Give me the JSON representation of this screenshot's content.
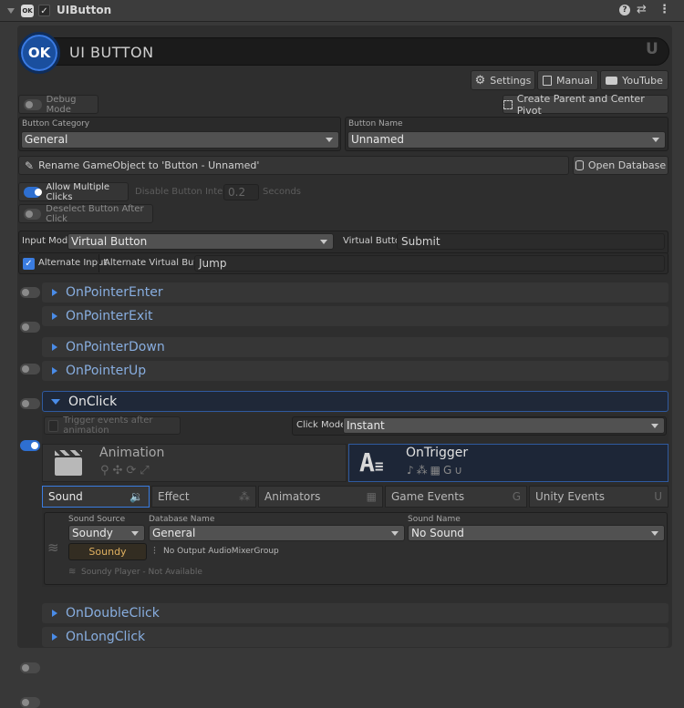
{
  "header": {
    "title": "UIButton"
  },
  "banner": {
    "logo": "OK",
    "title": "UI BUTTON"
  },
  "toolbar": {
    "settings": "Settings",
    "manual": "Manual",
    "youtube": "YouTube"
  },
  "debug_mode": "Debug Mode",
  "create_parent": "Create Parent and Center Pivot",
  "category": {
    "label": "Button Category",
    "value": "General"
  },
  "name": {
    "label": "Button Name",
    "value": "Unnamed"
  },
  "rename": "Rename GameObject to 'Button - Unnamed'",
  "open_db": "Open Database",
  "multi": {
    "allow": "Allow Multiple Clicks",
    "disable": "Disable Button Interval",
    "interval": "0.2",
    "seconds": "Seconds"
  },
  "deselect": "Deselect Button After Click",
  "input": {
    "mode_label": "Input Mode",
    "mode": "Virtual Button",
    "vb_label": "Virtual Button",
    "vb": "Submit",
    "alt": "Alternate Input",
    "alt_vb_label": "Alternate Virtual Button",
    "alt_vb": "Jump"
  },
  "events": {
    "enter": "OnPointerEnter",
    "exit": "OnPointerExit",
    "down": "OnPointerDown",
    "up": "OnPointerUp",
    "click": "OnClick",
    "double": "OnDoubleClick",
    "long": "OnLongClick"
  },
  "onclick": {
    "trigger": "Trigger events after animation",
    "mode_label": "Click Mode",
    "mode": "Instant",
    "animation": "Animation",
    "ontrigger": "OnTrigger"
  },
  "tabs": {
    "sound": "Sound",
    "effect": "Effect",
    "animators": "Animators",
    "game": "Game Events",
    "unity": "Unity Events"
  },
  "sound": {
    "src_label": "Sound Source",
    "src": "Soundy",
    "db_label": "Database Name",
    "db": "General",
    "name_label": "Sound Name",
    "name": "No Sound",
    "soundy": "Soundy",
    "mixer": "No Output AudioMixerGroup",
    "player": "Soundy Player - Not Available"
  }
}
